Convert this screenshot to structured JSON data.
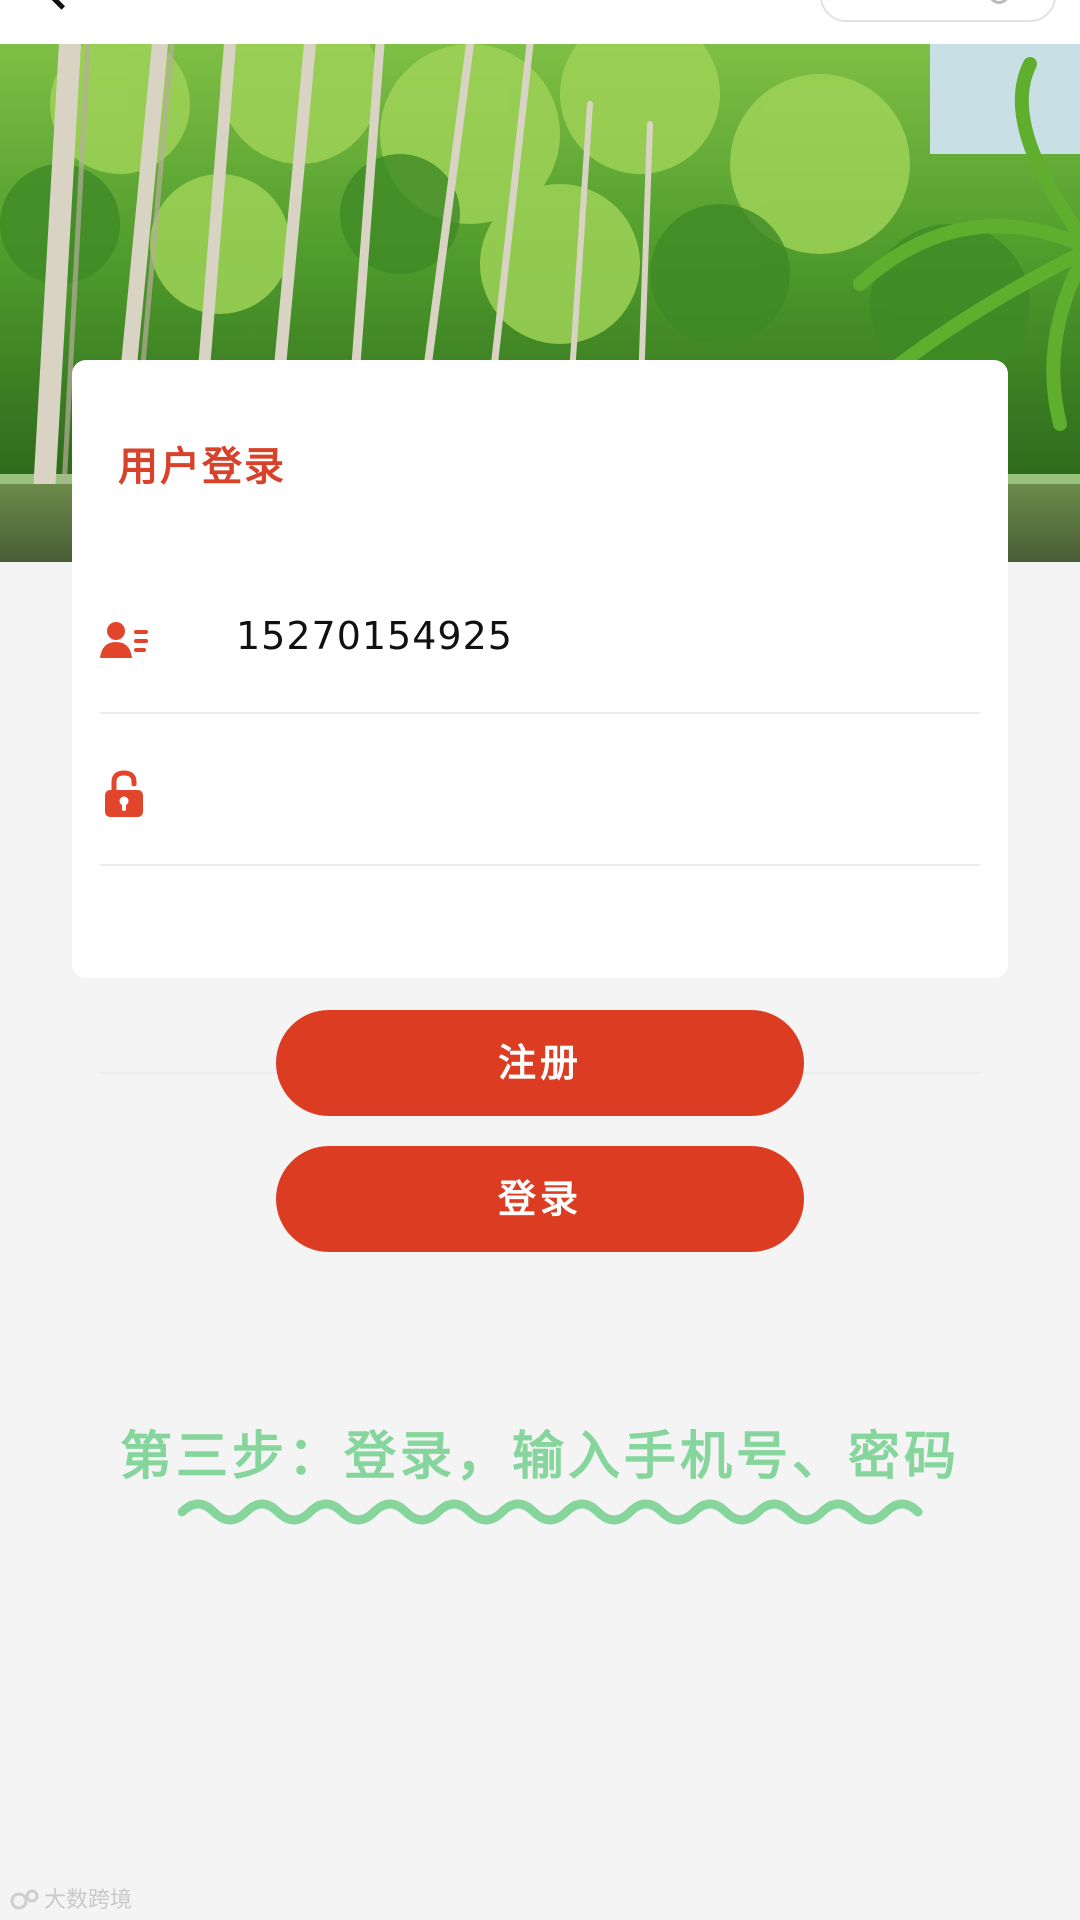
{
  "colors": {
    "accent": "#dc3d22",
    "title_red": "#d8412a",
    "caption_green": "#86d59d",
    "background": "#f4f4f4"
  },
  "icons": {
    "phone_field": "user-list-icon",
    "password_field": "unlock-icon"
  },
  "card": {
    "title": "用户登录"
  },
  "fields": {
    "phone_value": "15270154925",
    "password_value": ""
  },
  "buttons": {
    "register": "注册",
    "login": "登录"
  },
  "annotation": {
    "text": "第三步：登录，输入手机号、密码"
  },
  "watermark": {
    "text": "大数跨境"
  }
}
